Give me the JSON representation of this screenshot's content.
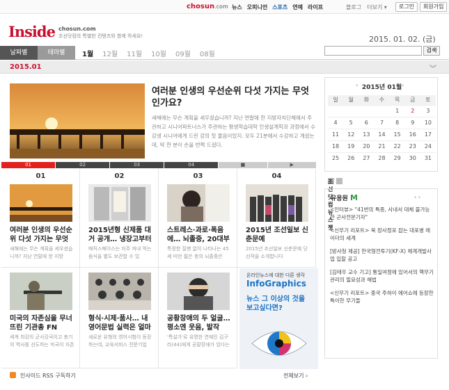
{
  "topbar": {
    "brand": "chosun",
    "brand_suffix": ".com",
    "nav": [
      "뉴스",
      "오피니언",
      "스포츠",
      "연예",
      "라이프"
    ],
    "links": [
      "블로그",
      "더보기 ▾"
    ],
    "login": "로그인",
    "join": "회원가입"
  },
  "header": {
    "logo": "Inside",
    "logo_sub1": "chosun.com",
    "logo_sub2": "조선닷컴의 특별한 컨텐츠와 함께 하세요!",
    "date": "2015. 01. 02. (금)"
  },
  "view_tabs": [
    "날짜별",
    "테마별"
  ],
  "months": [
    "1월",
    "12월",
    "11월",
    "10월",
    "09월",
    "08월"
  ],
  "search": {
    "button": "검색",
    "value": ""
  },
  "month_label": "2015.01",
  "feature": {
    "title": "여러분 인생의 우선순위 다섯 가지는 무엇인가요?",
    "desc": "새해에는 무슨 계획을 세우셨습니까? 지난 연말에 한 지방자치단체에서 주관하고 시니어파트너스가 주관하는 평생학습대학 인생설계학과 과정에서 수강생 시니어에게 드린 강의 첫 물음이었지. 모두 21분에서 수강하고 계셨는데, 딱 한 분이 손을 번쩍 드셨다."
  },
  "pager": [
    "01",
    "02",
    "03",
    "04",
    "■",
    "▶"
  ],
  "cards": [
    {
      "num": "01",
      "title": "여러분 인생의 우선순위 다섯 가지는 무엇인가요?",
      "desc": "새해에는 무슨 계획을 세우셨습니까? 지난 연말에 한 지방"
    },
    {
      "num": "02",
      "title": "2015년형 신제품 대거 공개… 냉장고부터",
      "desc": "매직스페이스는 자주 꺼내 먹는 음식을 별도 보관할 수 있"
    },
    {
      "num": "03",
      "title": "스트레스·과로·폭음에… 뇌졸중, 20대부터",
      "desc": "특정한 질병 없이 나타나는 45세 미만 젊은 층의 뇌졸중은"
    },
    {
      "num": "04",
      "title": "2015년 조선일보 신춘문예",
      "desc": "2015년 조선일보 신춘문예 당선작을 소개합니다"
    },
    {
      "title": "미국의 자존심을 무너뜨린 기관총 FN",
      "desc": "세계 최강의 군사강국이고 총기의 역사를 선도하는 미국이 자존심을 꺾고 도입했는"
    },
    {
      "title": "형식·시제·품사… 내 영어문법 실력은 얼마",
      "desc": "새로운 유형의 영어시험이 등장하는데, 교육서비스 전문기업 NE 능률(대표 황도순)은 전국"
    },
    {
      "title": "공황장애의 두 얼굴… 평소엔 웃음, 발작",
      "desc": "'특설가'로 유명한 연예인 김구라(44)에게 공황장애가 있다는 사실이 최근 밝혀졌다. 거침없"
    }
  ],
  "ad": {
    "line1": "온라인뉴스에 대한 다른 생각",
    "line2": "InfoGraphics",
    "line3": "뉴스 그 이상의 것을 보고싶다면?"
  },
  "footer": {
    "rss": "인사이드 RSS 구독하기",
    "viewall": "전체보기 ›"
  },
  "calendar": {
    "title": "2015년 01월",
    "prev": "‹",
    "next": "›",
    "days": [
      "일",
      "월",
      "화",
      "수",
      "목",
      "금",
      "토"
    ],
    "weeks": [
      [
        "",
        "",
        "",
        "",
        "1",
        "2",
        "3"
      ],
      [
        "4",
        "5",
        "6",
        "7",
        "8",
        "9",
        "10"
      ],
      [
        "11",
        "12",
        "13",
        "14",
        "15",
        "16",
        "17"
      ],
      [
        "18",
        "19",
        "20",
        "21",
        "22",
        "23",
        "24"
      ],
      [
        "25",
        "26",
        "27",
        "28",
        "29",
        "30",
        "31"
      ]
    ],
    "today": "2"
  },
  "news": {
    "title": "조선닷컴 뉴스젯",
    "name": "유용원",
    "name_mark": "M",
    "arrows": "‹ ›",
    "items": [
      "<인터뷰> \"41번의 특종, 사내서 대체 불가능한 군사전문기자\"",
      "<신무기 리포트> 북 장사정포 잡는 대포병 레이더의 세계",
      "[방사청 제공] 한국형전투기(KF-X) 체계개발사업 입찰 공고",
      "[김태우 교수 기고] 통일여정에 있어서의 핵무기 관리의 필요성과 해법",
      "<신무기 리포트> 중국 주하이 에어쇼에 등장한 특이한 무기들"
    ]
  },
  "colors": {
    "brand": "#c8102e",
    "accent_blue": "#1a72c2"
  }
}
